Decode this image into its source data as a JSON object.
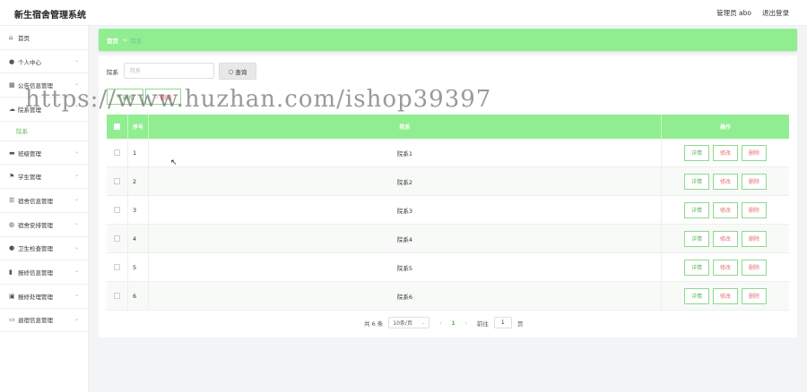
{
  "app": {
    "title": "新生宿舍管理系统"
  },
  "header": {
    "user_text": "管理员 abo",
    "logout_label": "退出登录"
  },
  "sidebar": {
    "items": [
      {
        "label": "首页",
        "icon": "home-icon",
        "glyph": "⌂",
        "has_chevron": false
      },
      {
        "label": "个人中心",
        "icon": "user-icon",
        "glyph": "●",
        "has_chevron": true
      },
      {
        "label": "公告信息管理",
        "icon": "grid-icon",
        "glyph": "▦",
        "has_chevron": true
      },
      {
        "label": "院系管理",
        "icon": "cloud-icon",
        "glyph": "☁",
        "has_chevron": true,
        "expanded": true
      },
      {
        "label": "院系",
        "sub": true
      },
      {
        "label": "班级管理",
        "icon": "card-icon",
        "glyph": "▬",
        "has_chevron": true
      },
      {
        "label": "学生管理",
        "icon": "flag-icon",
        "glyph": "⚑",
        "has_chevron": true
      },
      {
        "label": "宿舍信息管理",
        "icon": "list-icon",
        "glyph": "☰",
        "has_chevron": true
      },
      {
        "label": "宿舍安排管理",
        "icon": "globe-icon",
        "glyph": "◍",
        "has_chevron": true
      },
      {
        "label": "卫生检查管理",
        "icon": "person-icon",
        "glyph": "●",
        "has_chevron": true
      },
      {
        "label": "报修信息管理",
        "icon": "chart-icon",
        "glyph": "▮",
        "has_chevron": true
      },
      {
        "label": "报修处理管理",
        "icon": "trash-icon",
        "glyph": "▣",
        "has_chevron": true
      },
      {
        "label": "退宿信息管理",
        "icon": "panel-icon",
        "glyph": "▭",
        "has_chevron": true
      }
    ]
  },
  "breadcrumb": {
    "home": "首页",
    "separator": "→",
    "current": "院系"
  },
  "search": {
    "label": "院系",
    "placeholder": "院系",
    "value": "",
    "button_label": "查询",
    "button_icon": "search-icon"
  },
  "actions": {
    "add_label": "新增",
    "delete_label": "删除"
  },
  "table": {
    "headers": {
      "index": "序号",
      "name": "院系",
      "ops": "操作"
    },
    "rows": [
      {
        "index": "1",
        "name": "院系1"
      },
      {
        "index": "2",
        "name": "院系2"
      },
      {
        "index": "3",
        "name": "院系3"
      },
      {
        "index": "4",
        "name": "院系4"
      },
      {
        "index": "5",
        "name": "院系5"
      },
      {
        "index": "6",
        "name": "院系6"
      }
    ],
    "row_buttons": {
      "detail": "详情",
      "edit": "修改",
      "delete": "删除"
    }
  },
  "pagination": {
    "total_text": "共 6 条",
    "page_size": "10条/页",
    "prev": "‹",
    "current_page": "1",
    "next": "›",
    "goto_label": "前往",
    "goto_value": "1",
    "page_unit": "页"
  },
  "watermark": "https://www.huzhan.com/ishop39397",
  "colors": {
    "accent": "#90ee90",
    "accent_text": "#5cb85c",
    "danger": "#e57373"
  }
}
